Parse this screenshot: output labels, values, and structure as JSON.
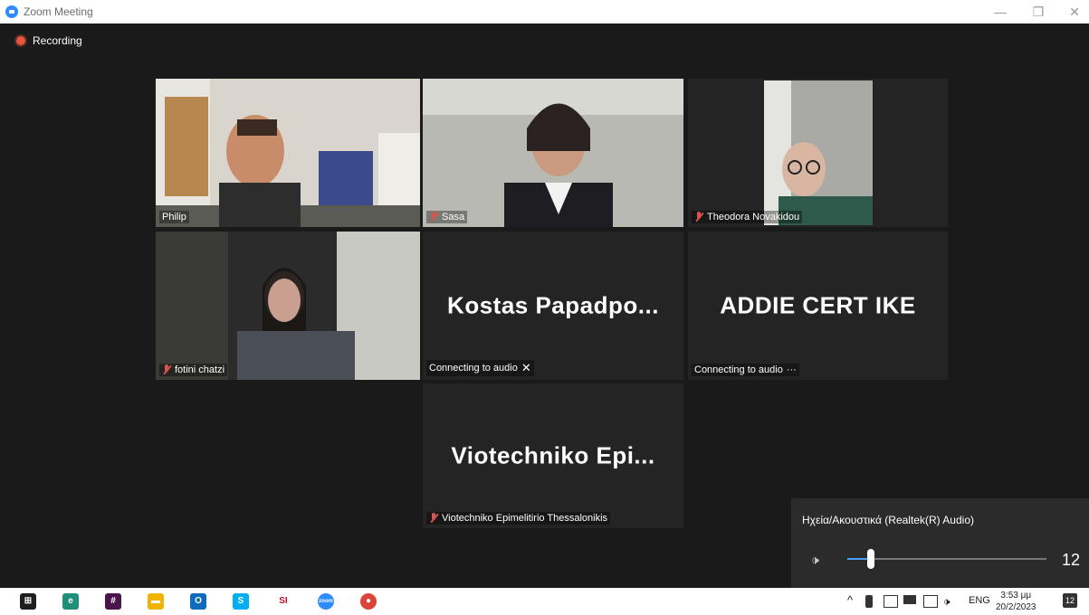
{
  "window": {
    "title": "Zoom Meeting",
    "minimize_glyph": "—",
    "restore_glyph": "❐",
    "close_glyph": "✕"
  },
  "recording": {
    "label": "Recording"
  },
  "tiles": [
    {
      "name": "Philip",
      "type": "video",
      "muted": false,
      "active": true
    },
    {
      "name": "Sasa",
      "type": "video",
      "muted": true
    },
    {
      "name": "Theodora Novakidou",
      "type": "video",
      "muted": true
    },
    {
      "name": "fotini chatzi",
      "type": "video",
      "muted": true
    },
    {
      "display_name": "Kostas  Papadpo...",
      "status": "Connecting to audio",
      "status_icon": "✕"
    },
    {
      "display_name": "ADDIE CERT IKE",
      "status": "Connecting to audio",
      "status_icon": "···"
    },
    {
      "display_name": "Viotechniko  Epi...",
      "name": "Viotechniko Epimelitirio Thessalonikis",
      "muted": true
    }
  ],
  "audio_flyout": {
    "device": "Ηχεία/Ακουστικά (Realtek(R) Audio)",
    "volume": "12",
    "volume_fraction": 0.12,
    "speaker_glyph": "🕩"
  },
  "taskbar": {
    "apps": [
      {
        "name": "windows-start",
        "color": "#1e1e1e",
        "glyph": "⊞"
      },
      {
        "name": "edge",
        "color": "#1f8f7a",
        "glyph": "e"
      },
      {
        "name": "slack",
        "color": "#4a154b",
        "glyph": "#"
      },
      {
        "name": "file-explorer",
        "color": "#f0b400",
        "glyph": "▬"
      },
      {
        "name": "outlook",
        "color": "#0f6cbd",
        "glyph": "O"
      },
      {
        "name": "skype",
        "color": "#00aff0",
        "glyph": "S"
      },
      {
        "name": "si-app",
        "color": "#ffffff",
        "glyph": "SI"
      },
      {
        "name": "zoom",
        "color": "#2d8cff",
        "glyph": "zoom"
      },
      {
        "name": "chrome",
        "color": "#db4437",
        "glyph": "●"
      }
    ],
    "tray_chevron": "^",
    "language": "ENG",
    "time": "3:53 μμ",
    "date": "20/2/2023",
    "notifications": "12"
  }
}
